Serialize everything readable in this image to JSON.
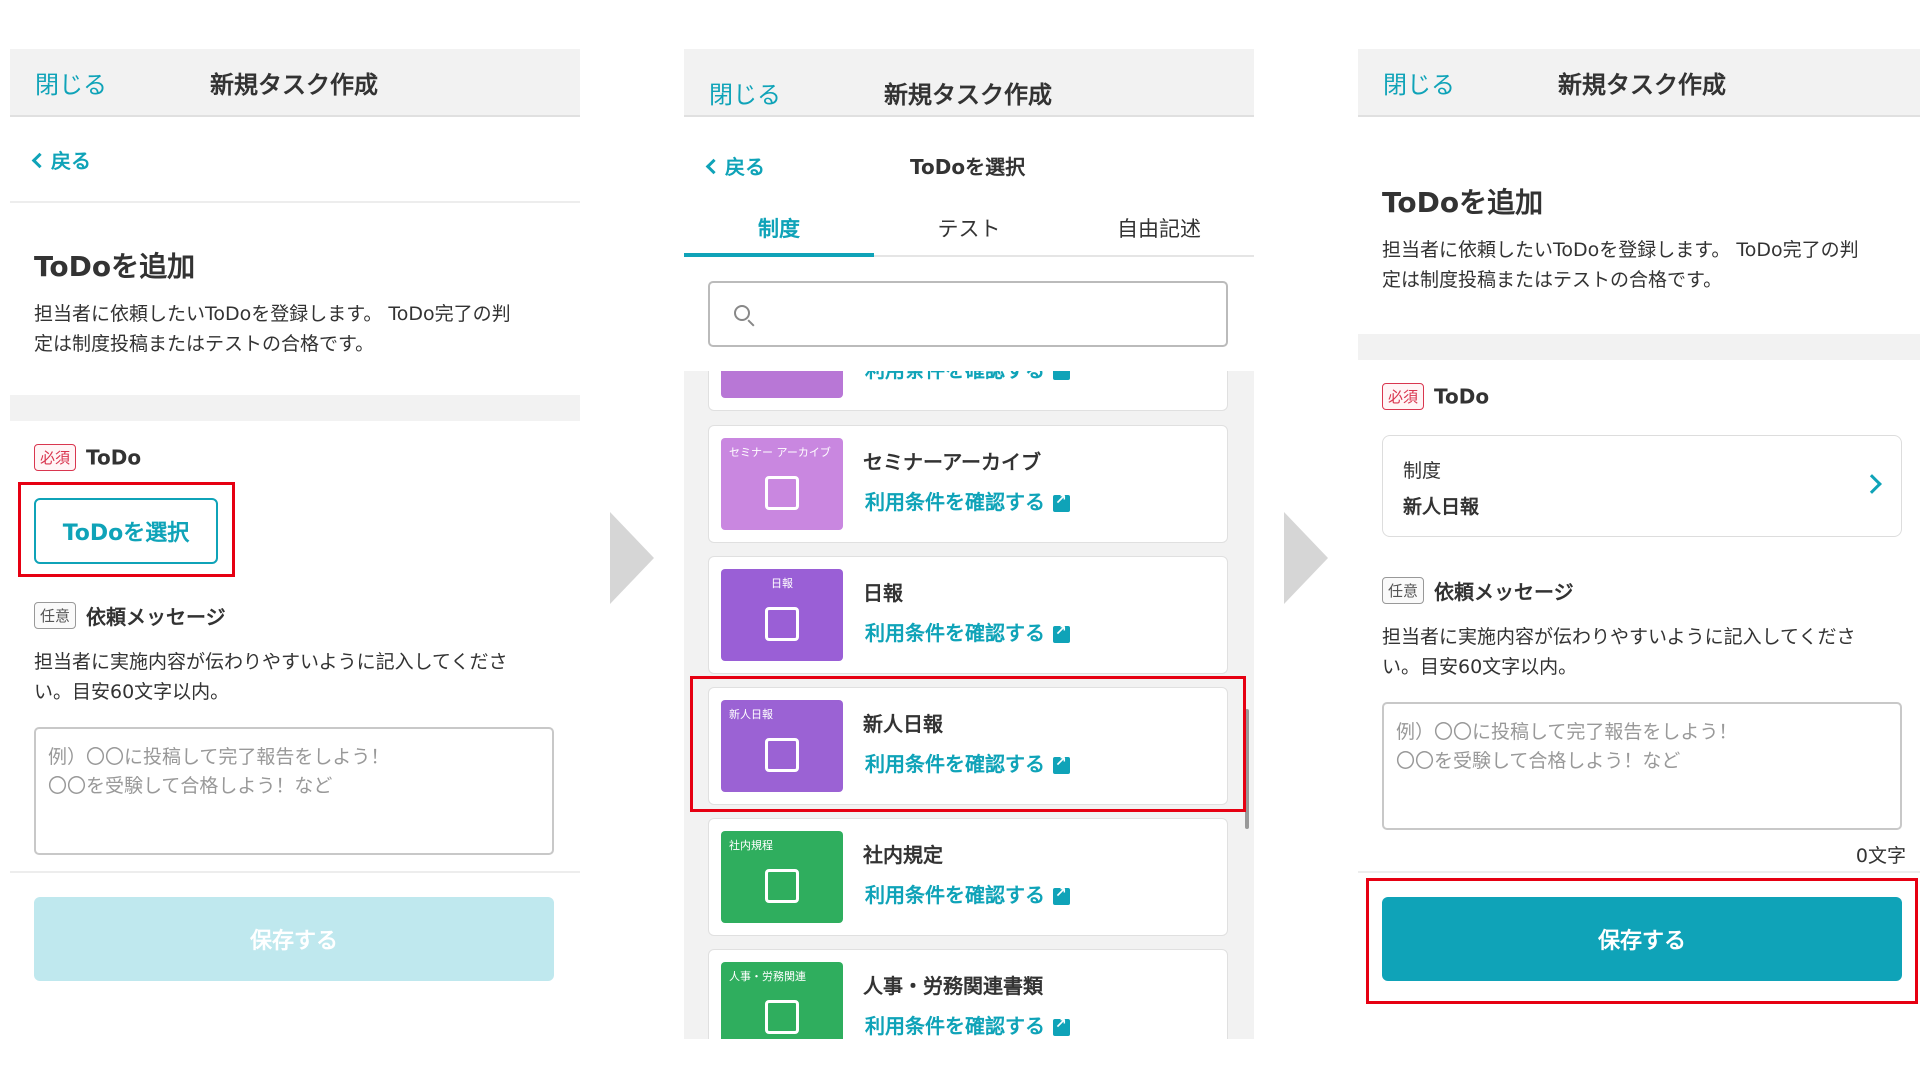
{
  "common": {
    "close_label": "閉じる",
    "title": "新規タスク作成",
    "back_label": "戻る",
    "heading": "ToDoを追加",
    "description": "担当者に依頼したいToDoを登録します。 ToDo完了の判定は制度投稿またはテストの合格です。",
    "required_badge": "必須",
    "todo_label": "ToDo",
    "optional_badge": "任意",
    "message_label": "依頼メッセージ",
    "message_help": "担当者に実施内容が伝わりやすいように記入してください。目安60文字以内。",
    "message_placeholder": "例）〇〇に投稿して完了報告をしよう！\n〇〇を受験して合格しよう！など",
    "save_label": "保存する"
  },
  "panel1": {
    "description_lines": [
      "担当者に依頼したいToDoを登録します。 ToDo完了の判",
      "定は制度投稿またはテストの合格です。"
    ],
    "select_button": "ToDoを選択",
    "help_lines": [
      "担当者に実施内容が伝わりやすいように記入してくださ",
      "い。目安60文字以内。"
    ],
    "placeholder_lines": [
      "例）〇〇に投稿して完了報告をしよう！",
      "〇〇を受験して合格しよう！など"
    ]
  },
  "panel2": {
    "subheader_title": "ToDoを選択",
    "tabs": [
      {
        "label": "制度",
        "active": true
      },
      {
        "label": "テスト",
        "active": false
      },
      {
        "label": "自由記述",
        "active": false
      }
    ],
    "link_label": "利用条件を確認する",
    "items": [
      {
        "title": "",
        "thumb_label": "",
        "color": "#b877d6"
      },
      {
        "title": "セミナーアーカイブ",
        "thumb_label": "セミナー アーカイブ",
        "color": "#c987e0"
      },
      {
        "title": "日報",
        "thumb_label": "日報",
        "color": "#9a5fd6"
      },
      {
        "title": "新人日報",
        "thumb_label": "新人日報",
        "color": "#9b62d4"
      },
      {
        "title": "社内規定",
        "thumb_label": "社内規程",
        "color": "#2fae5e"
      },
      {
        "title": "人事・労務関連書類",
        "thumb_label": "人事・労務関連",
        "color": "#2fae5e"
      }
    ]
  },
  "panel3": {
    "description_lines": [
      "担当者に依頼したいToDoを登録します。 ToDo完了の判",
      "定は制度投稿またはテストの合格です。"
    ],
    "selected_category": "制度",
    "selected_value": "新人日報",
    "help_lines": [
      "担当者に実施内容が伝わりやすいように記入してくださ",
      "い。目安60文字以内。"
    ],
    "placeholder_lines": [
      "例）〇〇に投稿して完了報告をしよう！",
      "〇〇を受験して合格しよう！など"
    ],
    "char_count": "0文字"
  },
  "colors": {
    "accent": "#0fa3b8",
    "highlight": "#e60012",
    "required": "#d9364f"
  }
}
